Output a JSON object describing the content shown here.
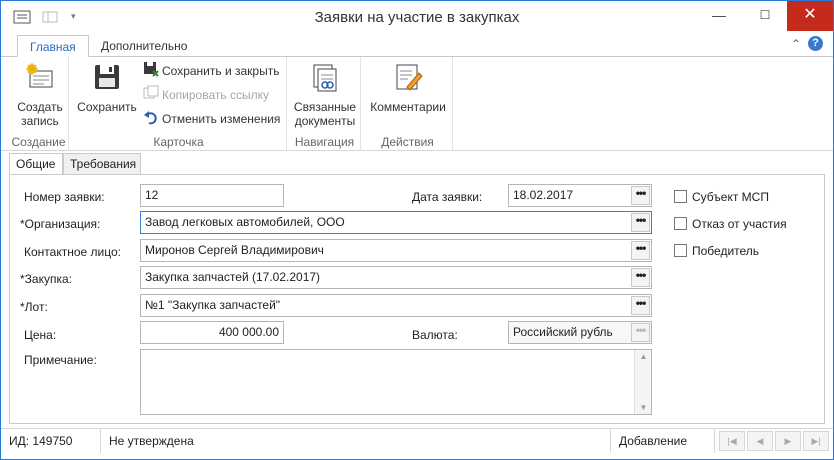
{
  "window": {
    "title": "Заявки на участие в закупках",
    "minimize": "—",
    "maximize": "☐",
    "close": "✕"
  },
  "ribbon_tabs": [
    {
      "label": "Главная"
    },
    {
      "label": "Дополнительно"
    }
  ],
  "ribbon_right": {
    "collapse": "⌃",
    "help": "?"
  },
  "ribbon": {
    "groups": {
      "creation": {
        "label": "Создание",
        "create": "Создать запись"
      },
      "card": {
        "label": "Карточка",
        "save": "Сохранить",
        "save_close": "Сохранить и закрыть",
        "copy_link": "Копировать ссылку",
        "cancel_changes": "Отменить изменения"
      },
      "navigation": {
        "label": "Навигация",
        "related": "Связанные документы"
      },
      "actions": {
        "label": "Действия",
        "comments": "Комментарии"
      }
    }
  },
  "form_tabs": [
    {
      "label": "Общие"
    },
    {
      "label": "Требования"
    }
  ],
  "form": {
    "number": {
      "label": "Номер заявки:",
      "value": "12"
    },
    "date": {
      "label": "Дата заявки:",
      "value": "18.02.2017"
    },
    "organization": {
      "label": "*Организация:",
      "value": "Завод легковых автомобилей, ООО"
    },
    "contact": {
      "label": "Контактное лицо:",
      "value": "Миронов Сергей Владимирович"
    },
    "purchase": {
      "label": "*Закупка:",
      "value": "Закупка запчастей (17.02.2017)"
    },
    "lot": {
      "label": "*Лот:",
      "value": "№1 \"Закупка запчастей\""
    },
    "price": {
      "label": "Цена:",
      "value": "400 000.00"
    },
    "currency": {
      "label": "Валюта:",
      "value": "Российский рубль"
    },
    "note": {
      "label": "Примечание:",
      "value": ""
    },
    "dots": "•••"
  },
  "checkboxes": [
    {
      "label": "Субъект МСП",
      "checked": false
    },
    {
      "label": "Отказ от участия",
      "checked": false
    },
    {
      "label": "Победитель",
      "checked": false
    }
  ],
  "status": {
    "id": "ИД: 149750",
    "approval": "Не утверждена",
    "mode": "Добавление",
    "nav": {
      "first": "|◀",
      "prev": "◀",
      "next": "▶",
      "last": "▶|"
    }
  },
  "colors": {
    "accent": "#2b79d6",
    "close": "#c42b1c"
  }
}
